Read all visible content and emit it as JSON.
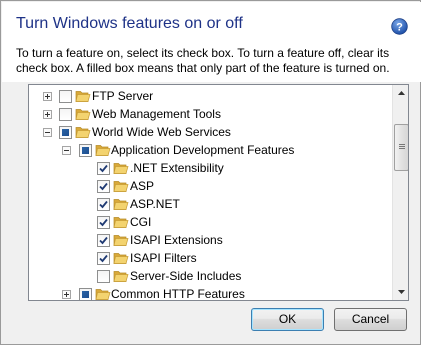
{
  "dialog": {
    "title": "Turn Windows features on or off",
    "description_line1": "To turn a feature on, select its check box. To turn a feature off, clear its",
    "description_line2": "check box. A filled box means that only part of the feature is turned on."
  },
  "tree": {
    "items": [
      {
        "label": "FTP Server",
        "expander": "plus",
        "check": "unchecked"
      },
      {
        "label": "Web Management Tools",
        "expander": "plus",
        "check": "unchecked"
      },
      {
        "label": "World Wide Web Services",
        "expander": "minus",
        "check": "partial"
      },
      {
        "label": "Application Development Features",
        "expander": "minus",
        "check": "partial"
      },
      {
        "label": ".NET Extensibility",
        "expander": "none",
        "check": "checked"
      },
      {
        "label": "ASP",
        "expander": "none",
        "check": "checked"
      },
      {
        "label": "ASP.NET",
        "expander": "none",
        "check": "checked"
      },
      {
        "label": "CGI",
        "expander": "none",
        "check": "checked"
      },
      {
        "label": "ISAPI Extensions",
        "expander": "none",
        "check": "checked"
      },
      {
        "label": "ISAPI Filters",
        "expander": "none",
        "check": "checked"
      },
      {
        "label": "Server-Side Includes",
        "expander": "none",
        "check": "unchecked"
      },
      {
        "label": "Common HTTP Features",
        "expander": "plus",
        "check": "partial"
      }
    ]
  },
  "buttons": {
    "ok_label": "OK",
    "cancel_label": "Cancel"
  },
  "icons": {
    "help": "help-icon",
    "folder": "folder-icon"
  },
  "colors": {
    "title": "#1e3287",
    "folder": "#e8c55e",
    "partial_fill": "#2b64a6"
  }
}
